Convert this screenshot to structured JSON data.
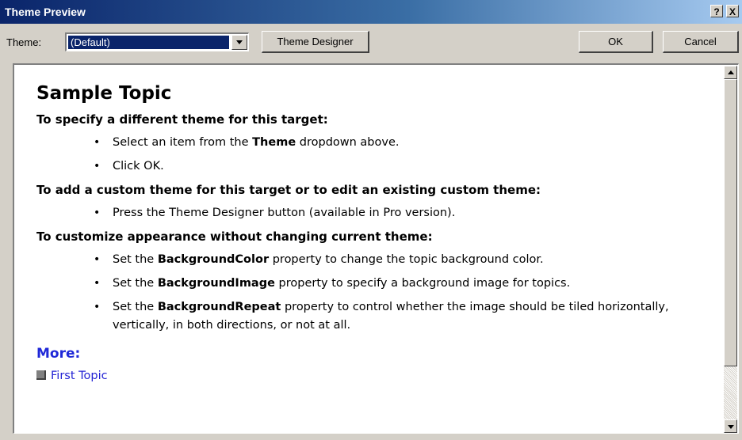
{
  "window": {
    "title": "Theme Preview",
    "help_label": "?",
    "close_label": "X"
  },
  "toolbar": {
    "theme_label": "Theme:",
    "theme_value": "(Default)",
    "designer_label": "Theme Designer",
    "ok_label": "OK",
    "cancel_label": "Cancel"
  },
  "preview": {
    "title": "Sample Topic",
    "sections": [
      {
        "heading": "To specify a different theme for this target:",
        "items": [
          {
            "pre": "Select an item from the ",
            "bold": "Theme",
            "post": " dropdown above."
          },
          {
            "pre": "Click OK.",
            "bold": "",
            "post": ""
          }
        ]
      },
      {
        "heading": "To add a custom theme for this target or to edit an existing custom theme:",
        "items": [
          {
            "pre": "Press the Theme Designer button (available in Pro version).",
            "bold": "",
            "post": ""
          }
        ]
      },
      {
        "heading": "To customize appearance without changing current theme:",
        "items": [
          {
            "pre": "Set the ",
            "bold": "BackgroundColor",
            "post": " property to change the topic background color."
          },
          {
            "pre": "Set the ",
            "bold": "BackgroundImage",
            "post": " property to specify a background image for topics."
          },
          {
            "pre": "Set the ",
            "bold": "BackgroundRepeat",
            "post": " property to control whether the image should be tiled horizontally, vertically, in both directions, or not at all."
          }
        ]
      }
    ],
    "bullet": "•",
    "more_label": "More:",
    "link_label": "First Topic"
  },
  "colors": {
    "titlebar_start": "#0a246a",
    "titlebar_end": "#a6caf0",
    "link": "#2323d4",
    "more_heading": "#1f28d8"
  }
}
